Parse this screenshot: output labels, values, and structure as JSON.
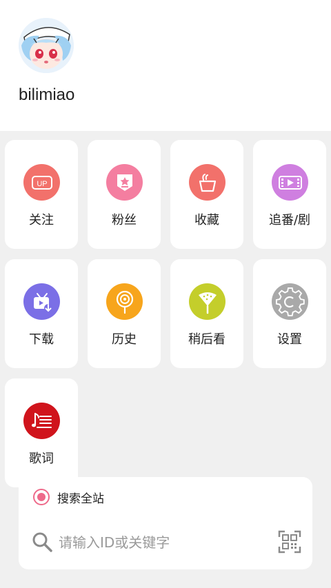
{
  "profile": {
    "username": "bilimiao"
  },
  "menu": [
    {
      "label": "关注",
      "icon": "up-icon",
      "color": "#f2716b"
    },
    {
      "label": "粉丝",
      "icon": "fan-badge-icon",
      "color": "#f47ea0"
    },
    {
      "label": "收藏",
      "icon": "favorites-cup-icon",
      "color": "#f2716b"
    },
    {
      "label": "追番/剧",
      "icon": "bangumi-film-icon",
      "color": "#cf7fe0"
    },
    {
      "label": "下载",
      "icon": "download-tv-icon",
      "color": "#7b6fe6"
    },
    {
      "label": "历史",
      "icon": "history-lollipop-icon",
      "color": "#f7a51c"
    },
    {
      "label": "稍后看",
      "icon": "watch-later-icecream-icon",
      "color": "#c4ce2b"
    },
    {
      "label": "设置",
      "icon": "gear-icon",
      "color": "#a9a9a9"
    },
    {
      "label": "歌词",
      "icon": "lyrics-icon",
      "color": "#d0141c"
    }
  ],
  "search": {
    "scope_label": "搜索全站",
    "placeholder": "请输入ID或关键字",
    "accent": "#ee6a8a"
  }
}
